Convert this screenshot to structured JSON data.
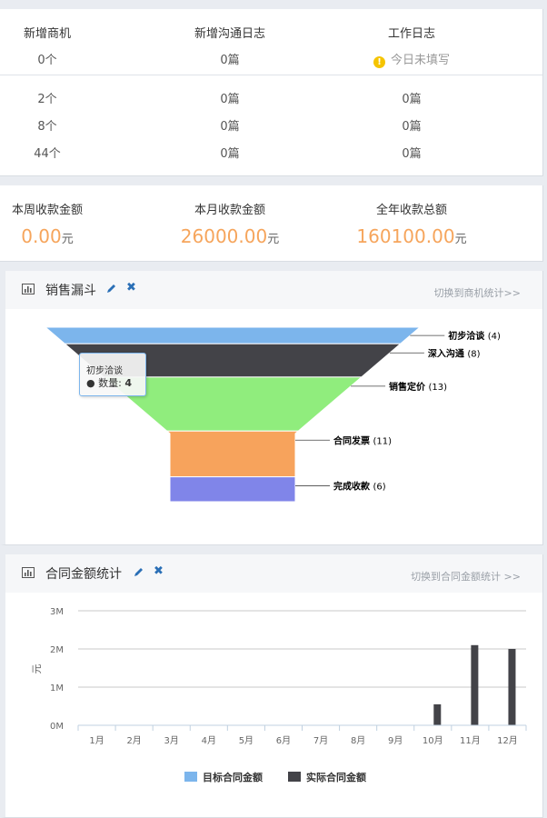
{
  "stats": {
    "headers": [
      "新增商机",
      "新增沟通日志",
      "工作日志"
    ],
    "today": [
      "0个",
      "0篇",
      "今日未填写"
    ],
    "rows": [
      [
        "2个",
        "0篇",
        "0篇"
      ],
      [
        "8个",
        "0篇",
        "0篇"
      ],
      [
        "44个",
        "0篇",
        "0篇"
      ]
    ]
  },
  "money": [
    {
      "label": "本周收款金额",
      "value": "0.00",
      "unit": "元"
    },
    {
      "label": "本月收款金额",
      "value": "26000.00",
      "unit": "元"
    },
    {
      "label": "全年收款总额",
      "value": "160100.00",
      "unit": "元"
    }
  ],
  "funnel_panel": {
    "title": "销售漏斗",
    "switch_link": "切换到商机统计>>",
    "tooltip": {
      "title": "初步洽谈",
      "label": "数量:",
      "value": "4"
    }
  },
  "contract_panel": {
    "title": "合同金额统计",
    "switch_link": "切换到合同金额统计 >>"
  },
  "chart_data": [
    {
      "type": "funnel",
      "categories": [
        "初步洽谈",
        "深入沟通",
        "销售定价",
        "合同发票",
        "完成收款"
      ],
      "values": [
        4,
        8,
        13,
        11,
        6
      ],
      "colors": [
        "#7cb5ec",
        "#434348",
        "#90ed7d",
        "#f7a35c",
        "#8085e9"
      ]
    },
    {
      "type": "bar",
      "categories": [
        "1月",
        "2月",
        "3月",
        "4月",
        "5月",
        "6月",
        "7月",
        "8月",
        "9月",
        "10月",
        "11月",
        "12月"
      ],
      "series": [
        {
          "name": "目标合同金额",
          "color": "#7cb5ec",
          "values": [
            0,
            0,
            0,
            0,
            0,
            0,
            0,
            0,
            0,
            0,
            0,
            0
          ]
        },
        {
          "name": "实际合同金额",
          "color": "#434348",
          "values": [
            0,
            0,
            0,
            0,
            0,
            0,
            0,
            0,
            0,
            550000,
            2100000,
            2000000
          ]
        }
      ],
      "ylabel": "元",
      "yticks": [
        "0M",
        "1M",
        "2M",
        "3M"
      ],
      "ylim": [
        0,
        3000000
      ],
      "grid": true,
      "legend": "bottom"
    }
  ]
}
